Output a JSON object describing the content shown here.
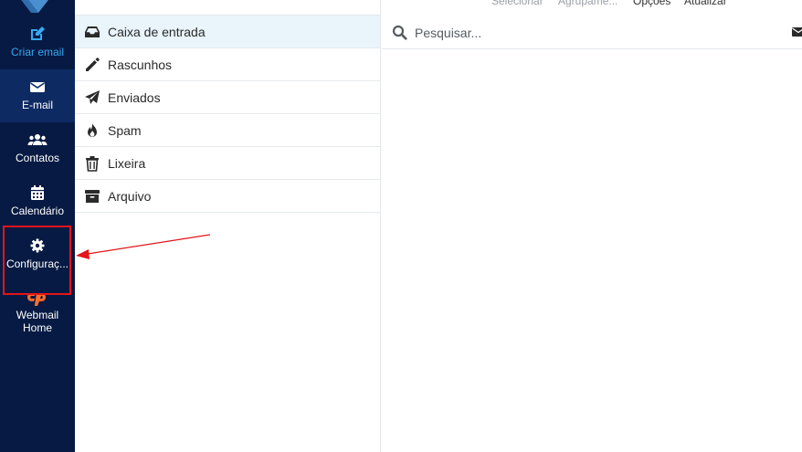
{
  "toolbar": {
    "select_label": "Selecionar",
    "group_label": "Agrupame...",
    "options_label": "Opções",
    "refresh_label": "Atualizar"
  },
  "nav": {
    "items": [
      {
        "label": "Criar email",
        "icon": "edit-icon"
      },
      {
        "label": "E-mail",
        "icon": "envelope-icon"
      },
      {
        "label": "Contatos",
        "icon": "users-icon"
      },
      {
        "label": "Calendário",
        "icon": "calendar-icon"
      },
      {
        "label": "Configuraç...",
        "icon": "gear-icon"
      },
      {
        "label": "Webmail Home",
        "icon": "cpanel-logo"
      }
    ]
  },
  "folders": [
    {
      "name": "Caixa de entrada",
      "icon": "inbox-icon"
    },
    {
      "name": "Rascunhos",
      "icon": "pencil-icon"
    },
    {
      "name": "Enviados",
      "icon": "paper-plane-icon"
    },
    {
      "name": "Spam",
      "icon": "fire-icon"
    },
    {
      "name": "Lixeira",
      "icon": "trash-icon"
    },
    {
      "name": "Arquivo",
      "icon": "archive-icon"
    }
  ],
  "search": {
    "placeholder": "Pesquisar..."
  },
  "colors": {
    "nav_bg": "#071a43",
    "nav_active": "#0e2a63",
    "accent": "#37a8f0",
    "highlight": "#e3151a",
    "selected_folder_bg": "#e9f4fb"
  }
}
